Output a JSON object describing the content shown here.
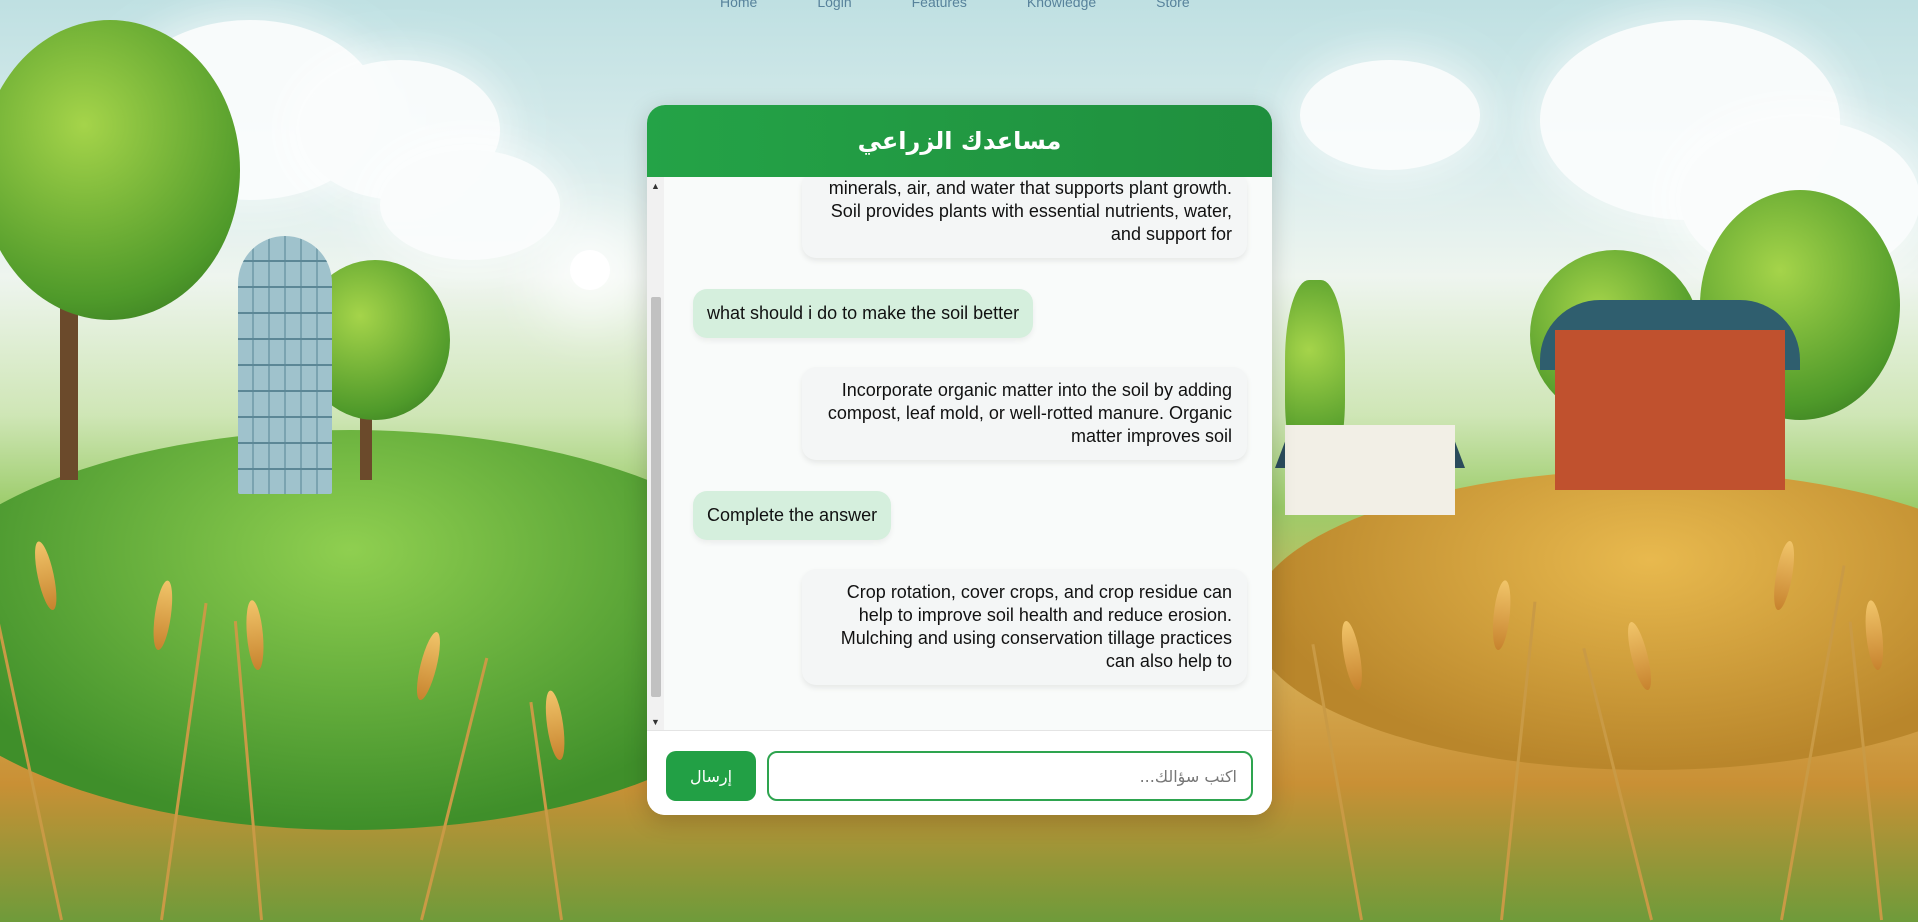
{
  "nav": {
    "items": [
      "Home",
      "Login",
      "Features",
      "Knowledge",
      "Store"
    ]
  },
  "chat": {
    "title": "مساعدك الزراعي",
    "messages": [
      {
        "role": "bot",
        "text": "minerals, air, and water that supports plant growth. Soil provides plants with essential nutrients, water, and support for"
      },
      {
        "role": "user",
        "text": "what should i do to make the soil better"
      },
      {
        "role": "bot",
        "text": "Incorporate organic matter into the soil by adding compost, leaf mold, or well-rotted manure. Organic matter improves soil"
      },
      {
        "role": "user",
        "text": "Complete the answer"
      },
      {
        "role": "bot",
        "text": "Crop rotation, cover crops, and crop residue can help to improve soil health and reduce erosion. Mulching and using conservation tillage practices can also help to"
      }
    ],
    "input": {
      "placeholder": "اكتب سؤالك...",
      "value": ""
    },
    "send_label": "إرسال"
  },
  "colors": {
    "header": "#24a347",
    "user_bubble": "#d5efdd",
    "bot_bubble": "#f4f6f6",
    "send_button": "#22a045"
  }
}
